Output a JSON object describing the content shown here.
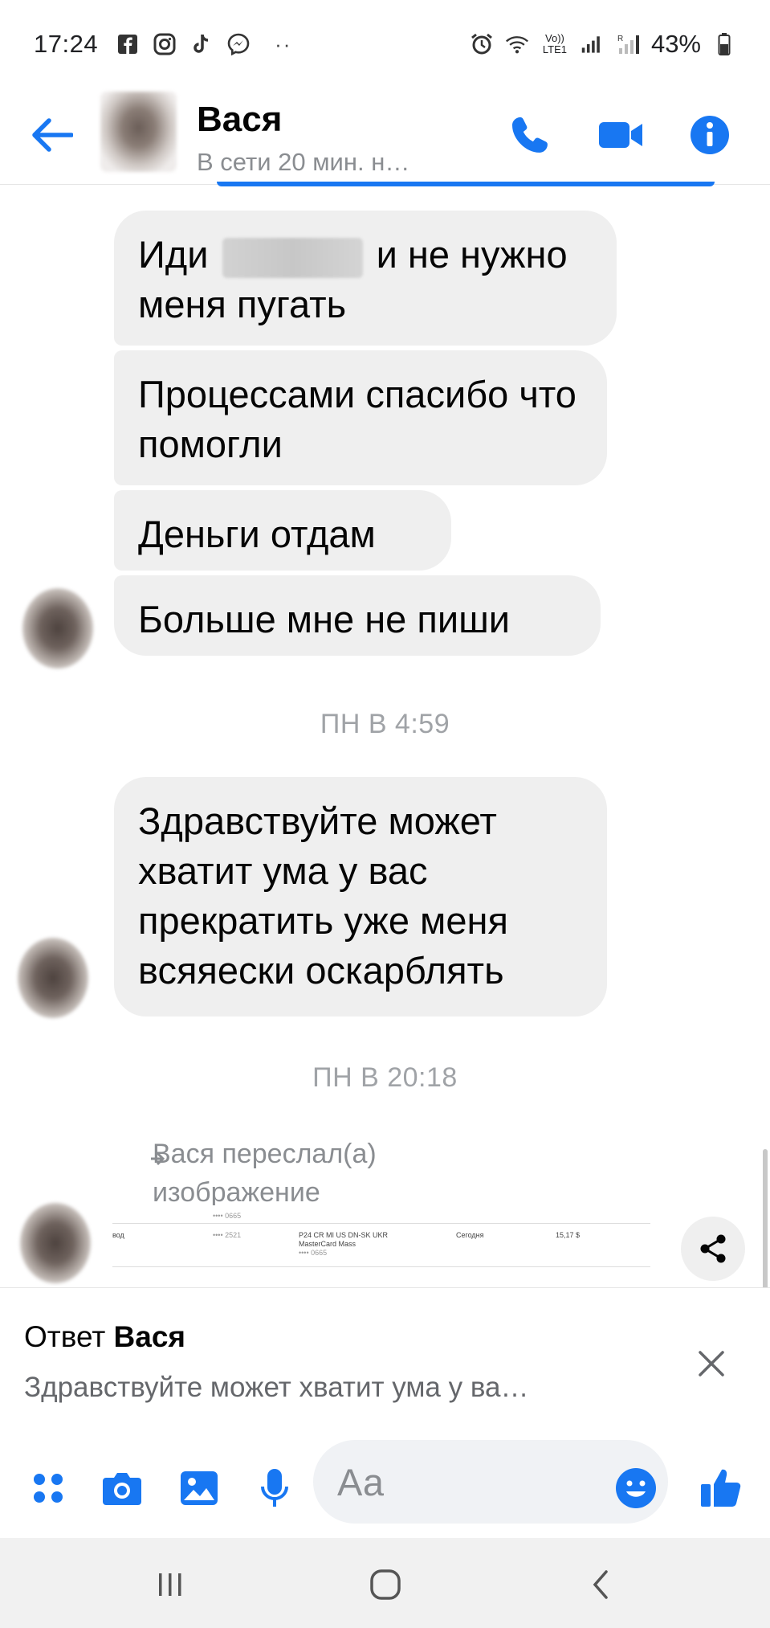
{
  "status_bar": {
    "time": "17:24",
    "battery": "43%",
    "network_label": "Vo)) LTE1",
    "more": "··"
  },
  "header": {
    "contact_name": "Вася",
    "status": "В сети 20 мин. н…",
    "accent_color": "#1877f2"
  },
  "messages": [
    {
      "text_before": "Иди",
      "text_after": "и не нужно меня пугать",
      "redacted": true
    },
    {
      "text": "Процессами спасибо что помогли"
    },
    {
      "text": "Деньги отдам"
    },
    {
      "text": "Больше мне не пиши"
    },
    {
      "text": "Здравствуйте может хватит ума у вас прекратить уже меня всяяески оскарблять"
    }
  ],
  "timestamps": [
    "ПН В 4:59",
    "ПН В 20:18"
  ],
  "forwarded": {
    "line1": "Вася переслал(а)",
    "line2": "изображение",
    "image_text": {
      "col1": "вод",
      "col2": "•••• 2521",
      "col3a": "P24 CR MI US DN-SK UKR",
      "col3b": "MasterCard Mass",
      "col3c": "•••• 0665",
      "col4": "Сегодня",
      "col5": "15,17 $",
      "top_small": "•••• 0665"
    }
  },
  "reply": {
    "prefix": "Ответ",
    "name": "Вася",
    "preview": "Здравствуйте может хватит ума у ва…"
  },
  "composer": {
    "placeholder": "Аа"
  },
  "icons": {
    "back": "arrow-left-icon",
    "call": "phone-icon",
    "video": "video-camera-icon",
    "info": "info-icon",
    "share": "share-icon",
    "close": "close-icon",
    "menu": "four-dots-icon",
    "camera": "camera-icon",
    "gallery": "image-icon",
    "mic": "microphone-icon",
    "emoji": "smiley-icon",
    "like": "thumbs-up-icon"
  }
}
